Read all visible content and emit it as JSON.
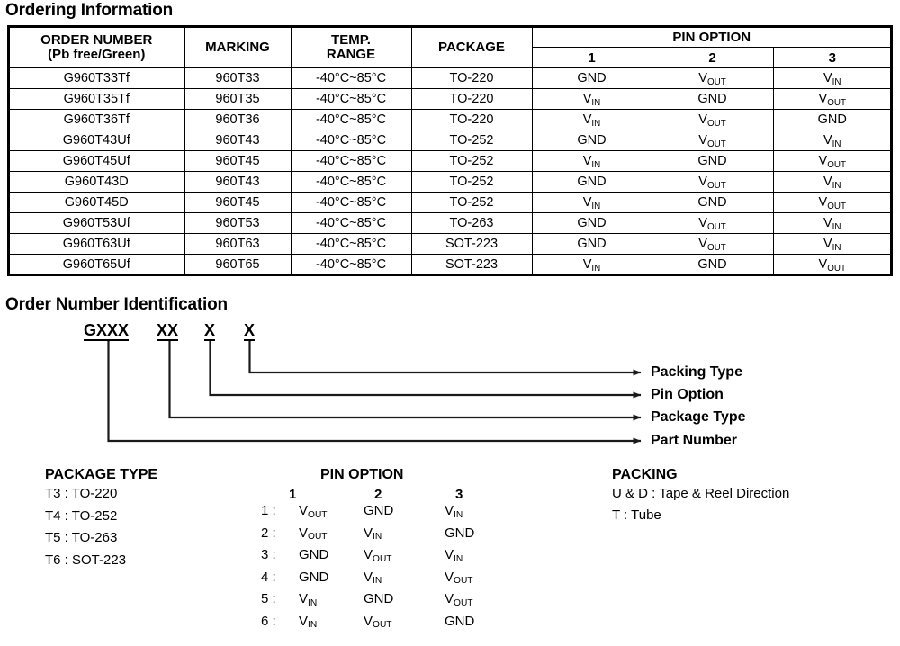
{
  "headings": {
    "ordering": "Ordering Information",
    "identification": "Order Number Identification"
  },
  "ordering_table": {
    "headers": {
      "order_number_line1": "ORDER NUMBER",
      "order_number_line2": "(Pb free/Green)",
      "marking": "MARKING",
      "temp_range_line1": "TEMP.",
      "temp_range_line2": "RANGE",
      "package": "PACKAGE",
      "pin_option": "PIN OPTION",
      "pin_1": "1",
      "pin_2": "2",
      "pin_3": "3"
    },
    "rows": [
      {
        "order": "G960T33Tf",
        "marking": "960T33",
        "temp": "-40°C~85°C",
        "package": "TO-220",
        "pin1": "GND",
        "pin1_sub": "",
        "pin2": "V",
        "pin2_sub": "OUT",
        "pin3": "V",
        "pin3_sub": "IN"
      },
      {
        "order": "G960T35Tf",
        "marking": "960T35",
        "temp": "-40°C~85°C",
        "package": "TO-220",
        "pin1": "V",
        "pin1_sub": "IN",
        "pin2": "GND",
        "pin2_sub": "",
        "pin3": "V",
        "pin3_sub": "OUT"
      },
      {
        "order": "G960T36Tf",
        "marking": "960T36",
        "temp": "-40°C~85°C",
        "package": "TO-220",
        "pin1": "V",
        "pin1_sub": "IN",
        "pin2": "V",
        "pin2_sub": "OUT",
        "pin3": "GND",
        "pin3_sub": ""
      },
      {
        "order": "G960T43Uf",
        "marking": "960T43",
        "temp": "-40°C~85°C",
        "package": "TO-252",
        "pin1": "GND",
        "pin1_sub": "",
        "pin2": "V",
        "pin2_sub": "OUT",
        "pin3": "V",
        "pin3_sub": "IN"
      },
      {
        "order": "G960T45Uf",
        "marking": "960T45",
        "temp": "-40°C~85°C",
        "package": "TO-252",
        "pin1": "V",
        "pin1_sub": "IN",
        "pin2": "GND",
        "pin2_sub": "",
        "pin3": "V",
        "pin3_sub": "OUT"
      },
      {
        "order": "G960T43D",
        "marking": "960T43",
        "temp": "-40°C~85°C",
        "package": "TO-252",
        "pin1": "GND",
        "pin1_sub": "",
        "pin2": "V",
        "pin2_sub": "OUT",
        "pin3": "V",
        "pin3_sub": "IN"
      },
      {
        "order": "G960T45D",
        "marking": "960T45",
        "temp": "-40°C~85°C",
        "package": "TO-252",
        "pin1": "V",
        "pin1_sub": "IN",
        "pin2": "GND",
        "pin2_sub": "",
        "pin3": "V",
        "pin3_sub": "OUT"
      },
      {
        "order": "G960T53Uf",
        "marking": "960T53",
        "temp": "-40°C~85°C",
        "package": "TO-263",
        "pin1": "GND",
        "pin1_sub": "",
        "pin2": "V",
        "pin2_sub": "OUT",
        "pin3": "V",
        "pin3_sub": "IN"
      },
      {
        "order": "G960T63Uf",
        "marking": "960T63",
        "temp": "-40°C~85°C",
        "package": "SOT-223",
        "pin1": "GND",
        "pin1_sub": "",
        "pin2": "V",
        "pin2_sub": "OUT",
        "pin3": "V",
        "pin3_sub": "IN"
      },
      {
        "order": "G960T65Uf",
        "marking": "960T65",
        "temp": "-40°C~85°C",
        "package": "SOT-223",
        "pin1": "V",
        "pin1_sub": "IN",
        "pin2": "GND",
        "pin2_sub": "",
        "pin3": "V",
        "pin3_sub": "OUT"
      }
    ]
  },
  "identification": {
    "tokens": {
      "part_number": "GXXX",
      "package_type": "XX",
      "pin_option": "X",
      "packing_type": "X"
    },
    "labels": {
      "packing_type": "Packing Type",
      "pin_option": "Pin Option",
      "package_type": "Package Type",
      "part_number": "Part Number"
    }
  },
  "legend": {
    "package_type": {
      "title": "PACKAGE TYPE",
      "rows": [
        "T3 : TO-220",
        "T4 : TO-252",
        "T5 : TO-263",
        "T6 : SOT-223"
      ]
    },
    "pin_option": {
      "title": "PIN OPTION",
      "col_headers": [
        "1",
        "2",
        "3"
      ],
      "rows": [
        {
          "label": "1 :",
          "p1": "V",
          "p1_sub": "OUT",
          "p2": "GND",
          "p2_sub": "",
          "p3": "V",
          "p3_sub": "IN"
        },
        {
          "label": "2 :",
          "p1": "V",
          "p1_sub": "OUT",
          "p2": "V",
          "p2_sub": "IN",
          "p3": "GND",
          "p3_sub": ""
        },
        {
          "label": "3 :",
          "p1": "GND",
          "p1_sub": "",
          "p2": "V",
          "p2_sub": "OUT",
          "p3": "V",
          "p3_sub": "IN"
        },
        {
          "label": "4 :",
          "p1": "GND",
          "p1_sub": "",
          "p2": "V",
          "p2_sub": "IN",
          "p3": "V",
          "p3_sub": "OUT"
        },
        {
          "label": "5 :",
          "p1": "V",
          "p1_sub": "IN",
          "p2": "GND",
          "p2_sub": "",
          "p3": "V",
          "p3_sub": "OUT"
        },
        {
          "label": "6 :",
          "p1": "V",
          "p1_sub": "IN",
          "p2": "V",
          "p2_sub": "OUT",
          "p3": "GND",
          "p3_sub": ""
        }
      ]
    },
    "packing": {
      "title": "PACKING",
      "rows": [
        "U & D : Tape & Reel Direction",
        "T : Tube"
      ]
    }
  },
  "colors": {
    "text": "#000000",
    "border": "#000000",
    "background": "#ffffff"
  }
}
